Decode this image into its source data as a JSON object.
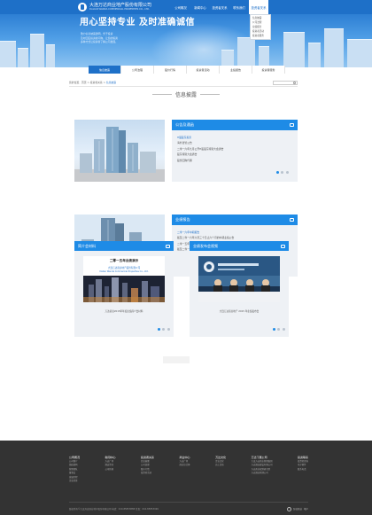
{
  "header": {
    "company_name": "大连万达商业地产股份有限公司",
    "company_name_en": "DALIAN WANDA COMMERCIAL PROPERTIES CO., LTD.",
    "nav": [
      {
        "label": "公司概况",
        "active": false
      },
      {
        "label": "新闻中心",
        "active": false
      },
      {
        "label": "投资者关系",
        "active": false
      },
      {
        "label": "联系我们",
        "active": false
      },
      {
        "label": "投资者关系",
        "active": true
      }
    ],
    "dropdown": [
      "信息披露",
      "公司治理",
      "业绩报告",
      "投资者活动",
      "投资者服务"
    ]
  },
  "banner": {
    "slogan": "用心坚持专业 及时准确诚信",
    "subtext": [
      "致力信息披露透明，务于投资",
      "及时回应投资者问询，让您的投资",
      "多种方式让投资者了解公司发展。"
    ]
  },
  "subnav": [
    {
      "label": "信息披露",
      "active": true
    },
    {
      "label": "公司治理",
      "active": false
    },
    {
      "label": "股价行情",
      "active": false
    },
    {
      "label": "投资者活动",
      "active": false
    },
    {
      "label": "业绩报告",
      "active": false
    },
    {
      "label": "投资者服务",
      "active": false
    }
  ],
  "breadcrumb": {
    "prefix": "您的位置：",
    "path": "首页 > 投资者关系 > ",
    "current": "信息披露"
  },
  "section_title": "信息披露",
  "announcements": {
    "title": "公告及通函",
    "items": [
      "H股股东投票",
      "海外监管公告",
      "二零一六年九月公开H股股东特别大会通告",
      "股东特别大会通告",
      "股份回购代理"
    ],
    "active_dot": 0
  },
  "results": {
    "title": "业绩报告",
    "items": [
      "二零一六年中期报告",
      "截至二零一六年六月三十日止六个月的中期业绩公告",
      "二零一五年年度报告",
      "截至二零一五年十二月三十一日止年度全年业绩公告"
    ],
    "active_dot": 2
  },
  "materials": {
    "title": "简介会材料",
    "doc_title": "二零一五年业绩演示",
    "doc_company": "大连万达商业地产股份有限公司",
    "doc_company_en": "Dalian Wanda Commercial Properties Co., Ltd.",
    "caption": "万达商业2015年年度业绩简介会材料",
    "active_dot": 0
  },
  "webcast": {
    "title": "业绩发布会视频",
    "caption": "大连万达商业地产 2015 年业绩发布会",
    "active_dot": 0
  },
  "footer": {
    "columns": [
      {
        "title": "公司概况",
        "items": [
          "公司简介",
          "组织架构",
          "管理团队",
          "董事会",
          "发展历程",
          "企业荣誉"
        ]
      },
      {
        "title": "新闻中心",
        "items": [
          "万达广场",
          "酒店资讯",
          "公司新闻"
        ]
      },
      {
        "title": "投资者关系",
        "items": [
          "信息披露",
          "公司治理",
          "股价行情",
          "投资者活动"
        ]
      },
      {
        "title": "商业中心",
        "items": [
          "万达广场",
          "商业综合体"
        ]
      },
      {
        "title": "万达文化",
        "items": [
          "企业文化",
          "员工活动"
        ]
      },
      {
        "title": "万达下属公司",
        "items": [
          "大连万达商业管理集团",
          "万达酒店建设有限公司",
          "万达商业规划研究院",
          "万达酒店管理公司"
        ]
      },
      {
        "title": "投资联系",
        "items": [
          "投资者咨询",
          "电子邮件",
          "联系电话"
        ]
      }
    ],
    "copyright": "版权所有©大连万达商业地产股份有限公司 电话：010-85853888 传真：010-85853999",
    "logo_label": "万达商业",
    "logo_label2": "地产"
  },
  "colors": {
    "primary": "#1e70c8",
    "accent": "#1e8be6",
    "footer": "#333333"
  }
}
